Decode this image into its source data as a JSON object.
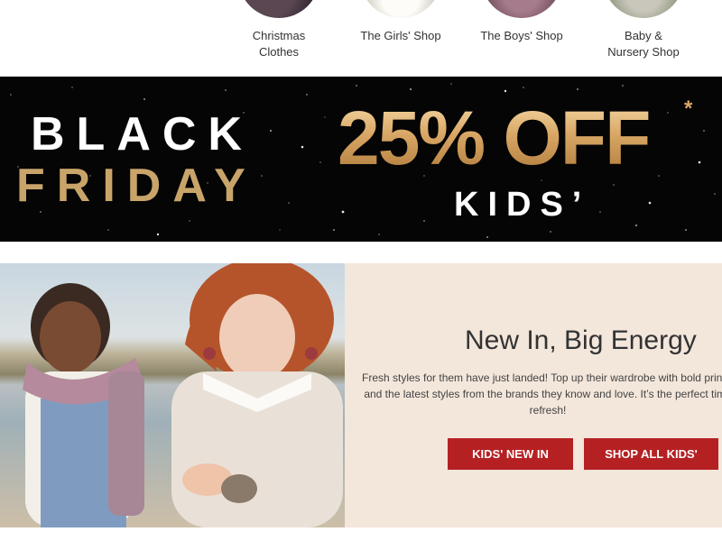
{
  "categories": [
    {
      "label": "Christmas\nClothes"
    },
    {
      "label": "The Girls' Shop"
    },
    {
      "label": "The Boys' Shop"
    },
    {
      "label": "Baby &\nNursery Shop"
    }
  ],
  "banner": {
    "line1": "BLACK",
    "line2": "FRIDAY",
    "offer": "25% OFF",
    "asterisk": "*",
    "audience": "KIDS’"
  },
  "promo": {
    "headline": "New In, Big Energy",
    "description": "Fresh styles for them have just landed! Top up their wardrobe with bold prints, and the latest styles from the brands they know and love. It’s the perfect time refresh!",
    "button_new": "KIDS' NEW IN",
    "button_all": "SHOP ALL KIDS'"
  },
  "colors": {
    "accent": "#b52123",
    "gold": "#c9a46a",
    "panel_bg": "#f3e6db"
  }
}
